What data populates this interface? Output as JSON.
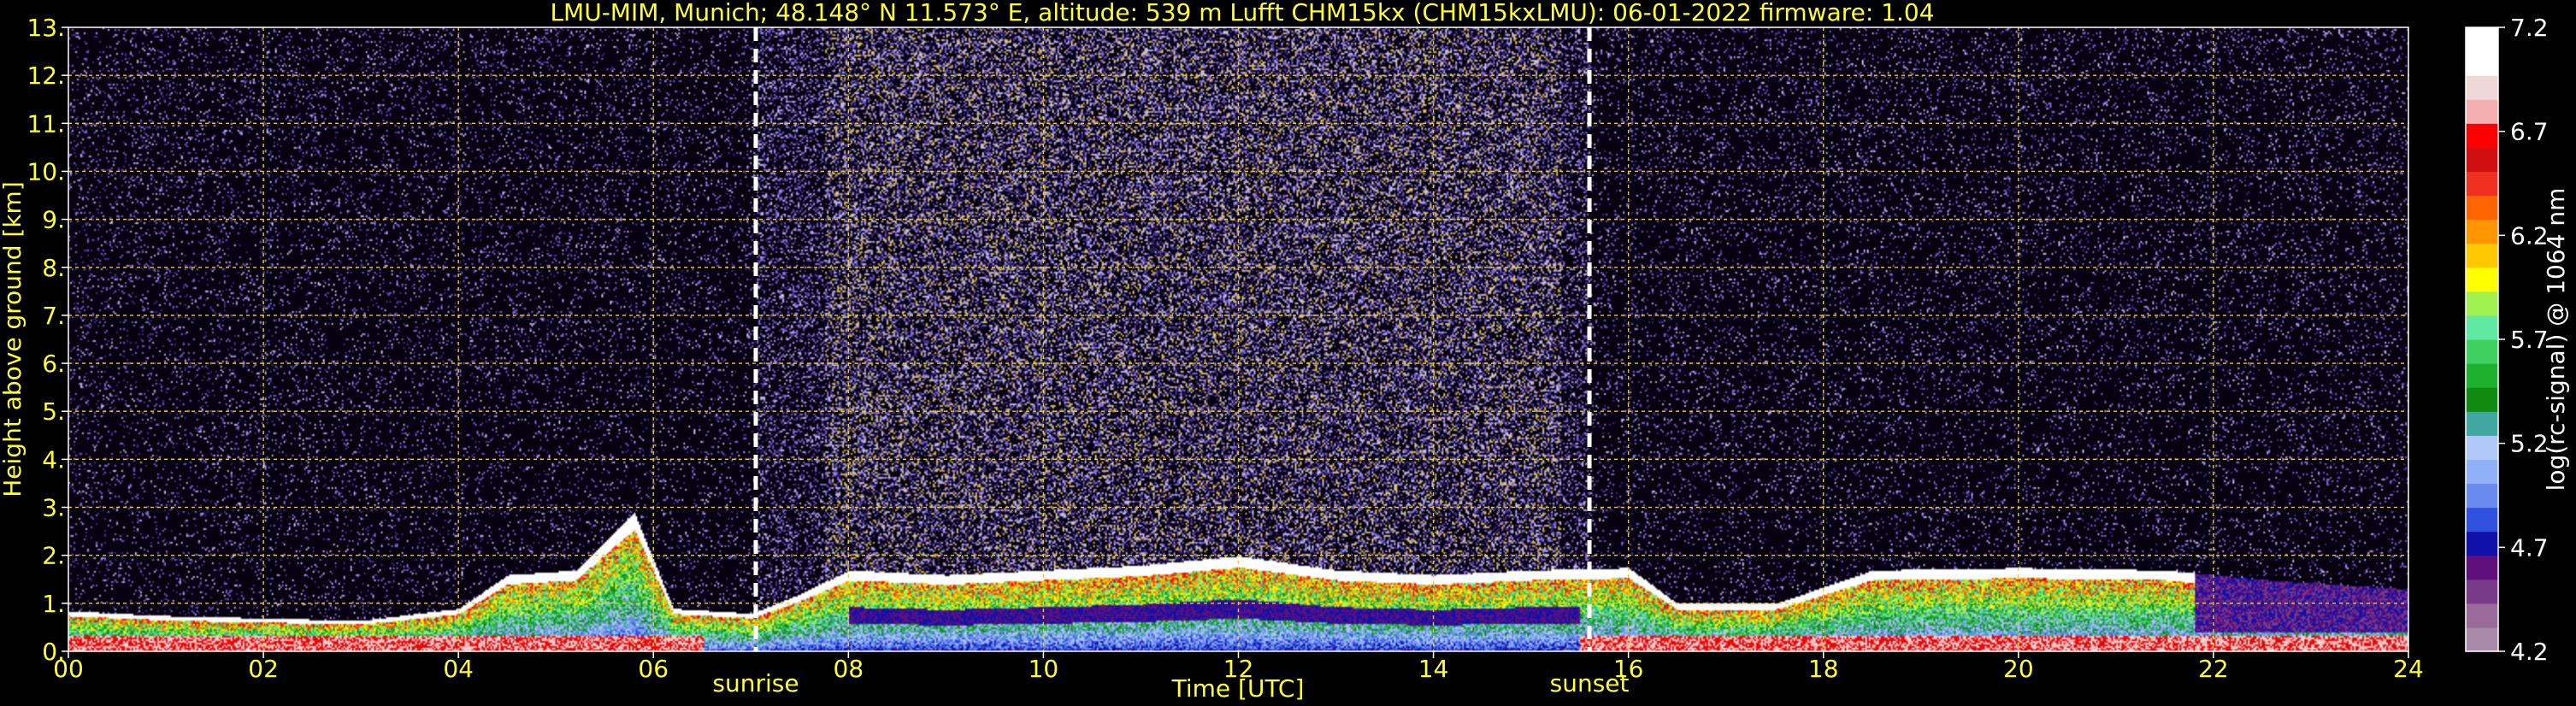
{
  "chart_data": {
    "type": "heatmap",
    "title": "LMU-MIM, Munich; 48.148° N 11.573° E, altitude: 539 m    Lufft CHM15kx (CHM15kxLMU): 06-01-2022    firmware: 1.04",
    "xlabel": "Time [UTC]",
    "ylabel": "Height above ground [km]",
    "xlim": [
      0,
      24
    ],
    "ylim": [
      0,
      13
    ],
    "x_ticks": [
      "00",
      "02",
      "04",
      "06",
      "08",
      "10",
      "12",
      "14",
      "16",
      "18",
      "20",
      "22",
      "24"
    ],
    "y_ticks": [
      "0.",
      "1.",
      "2.",
      "3.",
      "4.",
      "5.",
      "6.",
      "7.",
      "8.",
      "9.",
      "10.",
      "11.",
      "12.",
      "13."
    ],
    "grid": true,
    "events": [
      {
        "label": "sunrise",
        "time": 7.05
      },
      {
        "label": "sunset",
        "time": 15.6
      }
    ],
    "colorbar": {
      "label": "log(rc-signal) @ 1064 nm",
      "range": [
        4.2,
        7.2
      ],
      "ticks": [
        "4.2",
        "4.7",
        "5.2",
        "5.7",
        "6.2",
        "6.7",
        "7.2"
      ],
      "colors": [
        "#a88aa8",
        "#9a6a9a",
        "#7a3a8a",
        "#60107a",
        "#1010aa",
        "#3050e0",
        "#6a8af0",
        "#90b0f8",
        "#b0c8f8",
        "#40a8a0",
        "#108a10",
        "#20b030",
        "#40d060",
        "#60e8a0",
        "#a0f050",
        "#ffff00",
        "#ffc800",
        "#ff9600",
        "#ff6400",
        "#f03020",
        "#d01010",
        "#ff0000",
        "#f4b0b0",
        "#f0d8d8",
        "#ffffff",
        "#ffffff"
      ]
    },
    "profile_layers": [
      {
        "t": 0.0,
        "top": 0.85
      },
      {
        "t": 1.0,
        "top": 0.75
      },
      {
        "t": 2.0,
        "top": 0.7
      },
      {
        "t": 3.0,
        "top": 0.65
      },
      {
        "t": 4.0,
        "top": 0.9
      },
      {
        "t": 4.5,
        "top": 1.6
      },
      {
        "t": 5.2,
        "top": 1.7
      },
      {
        "t": 5.8,
        "top": 2.9
      },
      {
        "t": 6.2,
        "top": 0.9
      },
      {
        "t": 7.0,
        "top": 0.8
      },
      {
        "t": 7.5,
        "top": 1.2
      },
      {
        "t": 8.0,
        "top": 1.7
      },
      {
        "t": 9.0,
        "top": 1.6
      },
      {
        "t": 10.0,
        "top": 1.7
      },
      {
        "t": 11.0,
        "top": 1.8
      },
      {
        "t": 12.0,
        "top": 2.0
      },
      {
        "t": 13.0,
        "top": 1.7
      },
      {
        "t": 14.0,
        "top": 1.6
      },
      {
        "t": 15.0,
        "top": 1.7
      },
      {
        "t": 16.0,
        "top": 1.75
      },
      {
        "t": 16.5,
        "top": 1.0
      },
      {
        "t": 17.5,
        "top": 1.0
      },
      {
        "t": 18.5,
        "top": 1.7
      },
      {
        "t": 20.0,
        "top": 1.75
      },
      {
        "t": 21.5,
        "top": 1.7
      },
      {
        "t": 22.5,
        "top": 1.5
      },
      {
        "t": 24.0,
        "top": 1.3
      }
    ]
  }
}
